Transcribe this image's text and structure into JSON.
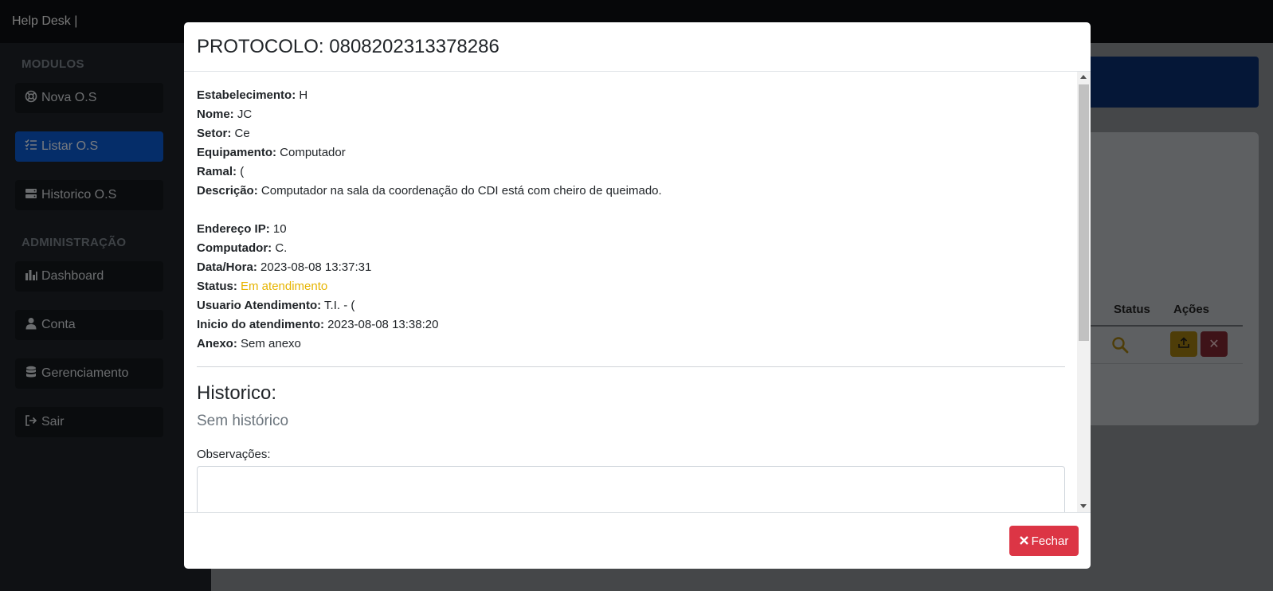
{
  "app": {
    "brand": "Help Desk |"
  },
  "sidebar": {
    "section_modulos": "MODULOS",
    "section_admin": "ADMINISTRAÇÃO",
    "items": [
      {
        "label": "Nova O.S",
        "icon": "lifebuoy-icon"
      },
      {
        "label": "Listar O.S",
        "icon": "list-check-icon",
        "active": true
      },
      {
        "label": "Historico O.S",
        "icon": "server-icon"
      },
      {
        "label": "Dashboard",
        "icon": "bar-chart-icon"
      },
      {
        "label": "Conta",
        "icon": "user-icon"
      },
      {
        "label": "Gerenciamento",
        "icon": "database-icon"
      },
      {
        "label": "Sair",
        "icon": "sign-out-icon"
      }
    ]
  },
  "table": {
    "headers": [
      "Status",
      "Ações"
    ]
  },
  "modal": {
    "title": "PROTOCOLO: 0808202313378286",
    "fields": {
      "estabelecimento": {
        "label": "Estabelecimento:",
        "value": "H"
      },
      "nome": {
        "label": "Nome:",
        "value": "JC"
      },
      "setor": {
        "label": "Setor:",
        "value": "Ce"
      },
      "equipamento": {
        "label": "Equipamento:",
        "value": "Computador"
      },
      "ramal": {
        "label": "Ramal:",
        "value": "("
      },
      "descricao": {
        "label": "Descrição:",
        "value": "Computador na sala da coordenação do CDI está com cheiro de queimado."
      },
      "ip": {
        "label": "Endereço IP:",
        "value": "10"
      },
      "computador": {
        "label": "Computador:",
        "value": "C."
      },
      "datahora": {
        "label": "Data/Hora:",
        "value": "2023-08-08 13:37:31"
      },
      "status": {
        "label": "Status:",
        "value": "Em atendimento"
      },
      "usuario": {
        "label": "Usuario Atendimento:",
        "value": "T.I. - ("
      },
      "inicio": {
        "label": "Inicio do atendimento:",
        "value": "2023-08-08 13:38:20"
      },
      "anexo": {
        "label": "Anexo:",
        "value": "Sem anexo"
      }
    },
    "historico_title": "Historico:",
    "historico_empty": "Sem histórico",
    "observacoes_label": "Observações:",
    "observacoes_value": "",
    "close_label": "Fechar"
  },
  "colors": {
    "status": "#e6b400",
    "primary": "#0b5bd3",
    "danger": "#dc3545"
  }
}
